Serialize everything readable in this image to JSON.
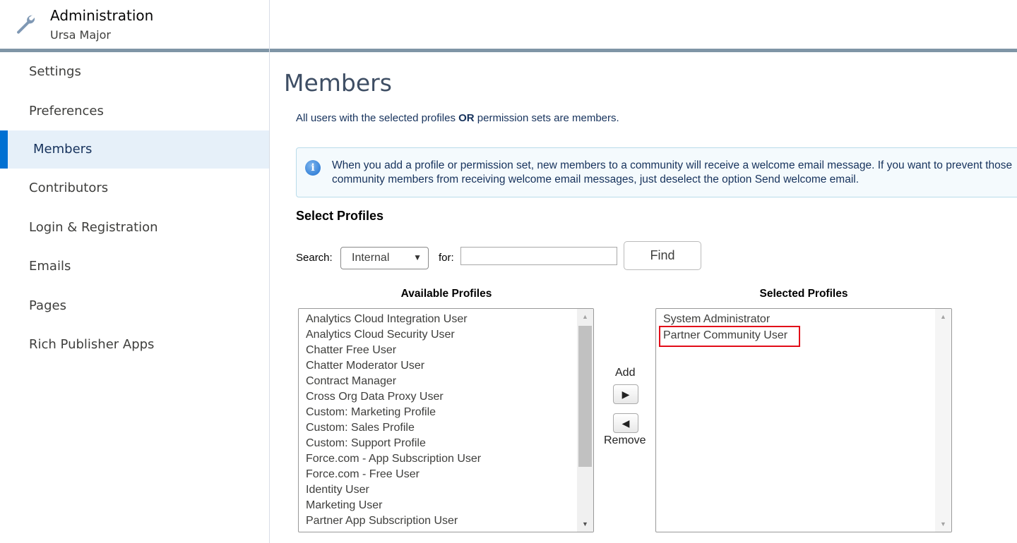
{
  "header": {
    "title": "Administration",
    "subtitle": "Ursa Major",
    "icon": "wrench-icon"
  },
  "sidebar": {
    "items": [
      {
        "label": "Settings"
      },
      {
        "label": "Preferences"
      },
      {
        "label": "Members",
        "active": true
      },
      {
        "label": "Contributors"
      },
      {
        "label": "Login & Registration"
      },
      {
        "label": "Emails"
      },
      {
        "label": "Pages"
      },
      {
        "label": "Rich Publisher Apps"
      }
    ]
  },
  "main": {
    "title": "Members",
    "intro_pre": "All users with the selected profiles ",
    "intro_bold": "OR",
    "intro_post": " permission sets are members.",
    "info": "When you add a profile or permission set, new members to a community will receive a welcome email message. If you want to prevent those community members from receiving welcome email messages, just deselect the option Send welcome email.",
    "section": "Select Profiles",
    "search_label": "Search:",
    "search_select": "Internal",
    "for_label": "for:",
    "for_value": "",
    "find": "Find",
    "available_header": "Available Profiles",
    "selected_header": "Selected Profiles",
    "add": "Add",
    "remove": "Remove",
    "available": [
      "Analytics Cloud Integration User",
      "Analytics Cloud Security User",
      "Chatter Free User",
      "Chatter Moderator User",
      "Contract Manager",
      "Cross Org Data Proxy User",
      "Custom: Marketing Profile",
      "Custom: Sales Profile",
      "Custom: Support Profile",
      "Force.com - App Subscription User",
      "Force.com - Free User",
      "Identity User",
      "Marketing User",
      "Partner App Subscription User"
    ],
    "selected": [
      "System Administrator",
      "Partner Community User"
    ],
    "highlight_color": "#e20c18"
  }
}
